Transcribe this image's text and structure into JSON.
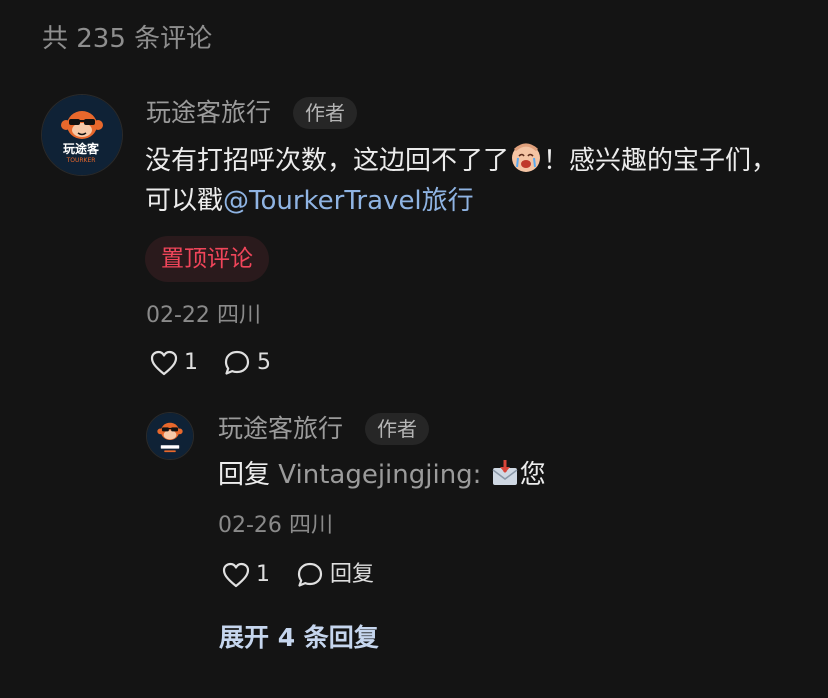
{
  "header": {
    "comment_count_label": "共 235 条评论"
  },
  "comment": {
    "author": "玩途客旅行",
    "author_badge": "作者",
    "avatar_text": "玩途客",
    "avatar_subtext": "TOURKER",
    "text_line1_a": "没有打招呼次数，这边回不了了",
    "text_line1_b": "！感兴趣的宝子们，",
    "text_line2_a": "可以戳",
    "text_mention": "@TourkerTravel旅行",
    "emoji": "crying-face-emoji",
    "pinned_label": "置顶评论",
    "date": "02-22",
    "location": "四川",
    "like_count": "1",
    "reply_count": "5"
  },
  "reply": {
    "author": "玩途客旅行",
    "author_badge": "作者",
    "avatar_text": "玩途客",
    "avatar_subtext": "TOURKER",
    "prefix": "回复",
    "reply_to": "Vintagejingjing:",
    "emoji": "inbox-tray-emoji",
    "text": "您",
    "date": "02-26",
    "location": "四川",
    "like_count": "1",
    "reply_label": "回复"
  },
  "more": {
    "expand_label": "展开 4 条回复"
  },
  "colors": {
    "background": "#141414",
    "pinned_text": "#f0455a",
    "mention": "#8fb4e3",
    "expand": "#c6d6ee"
  }
}
